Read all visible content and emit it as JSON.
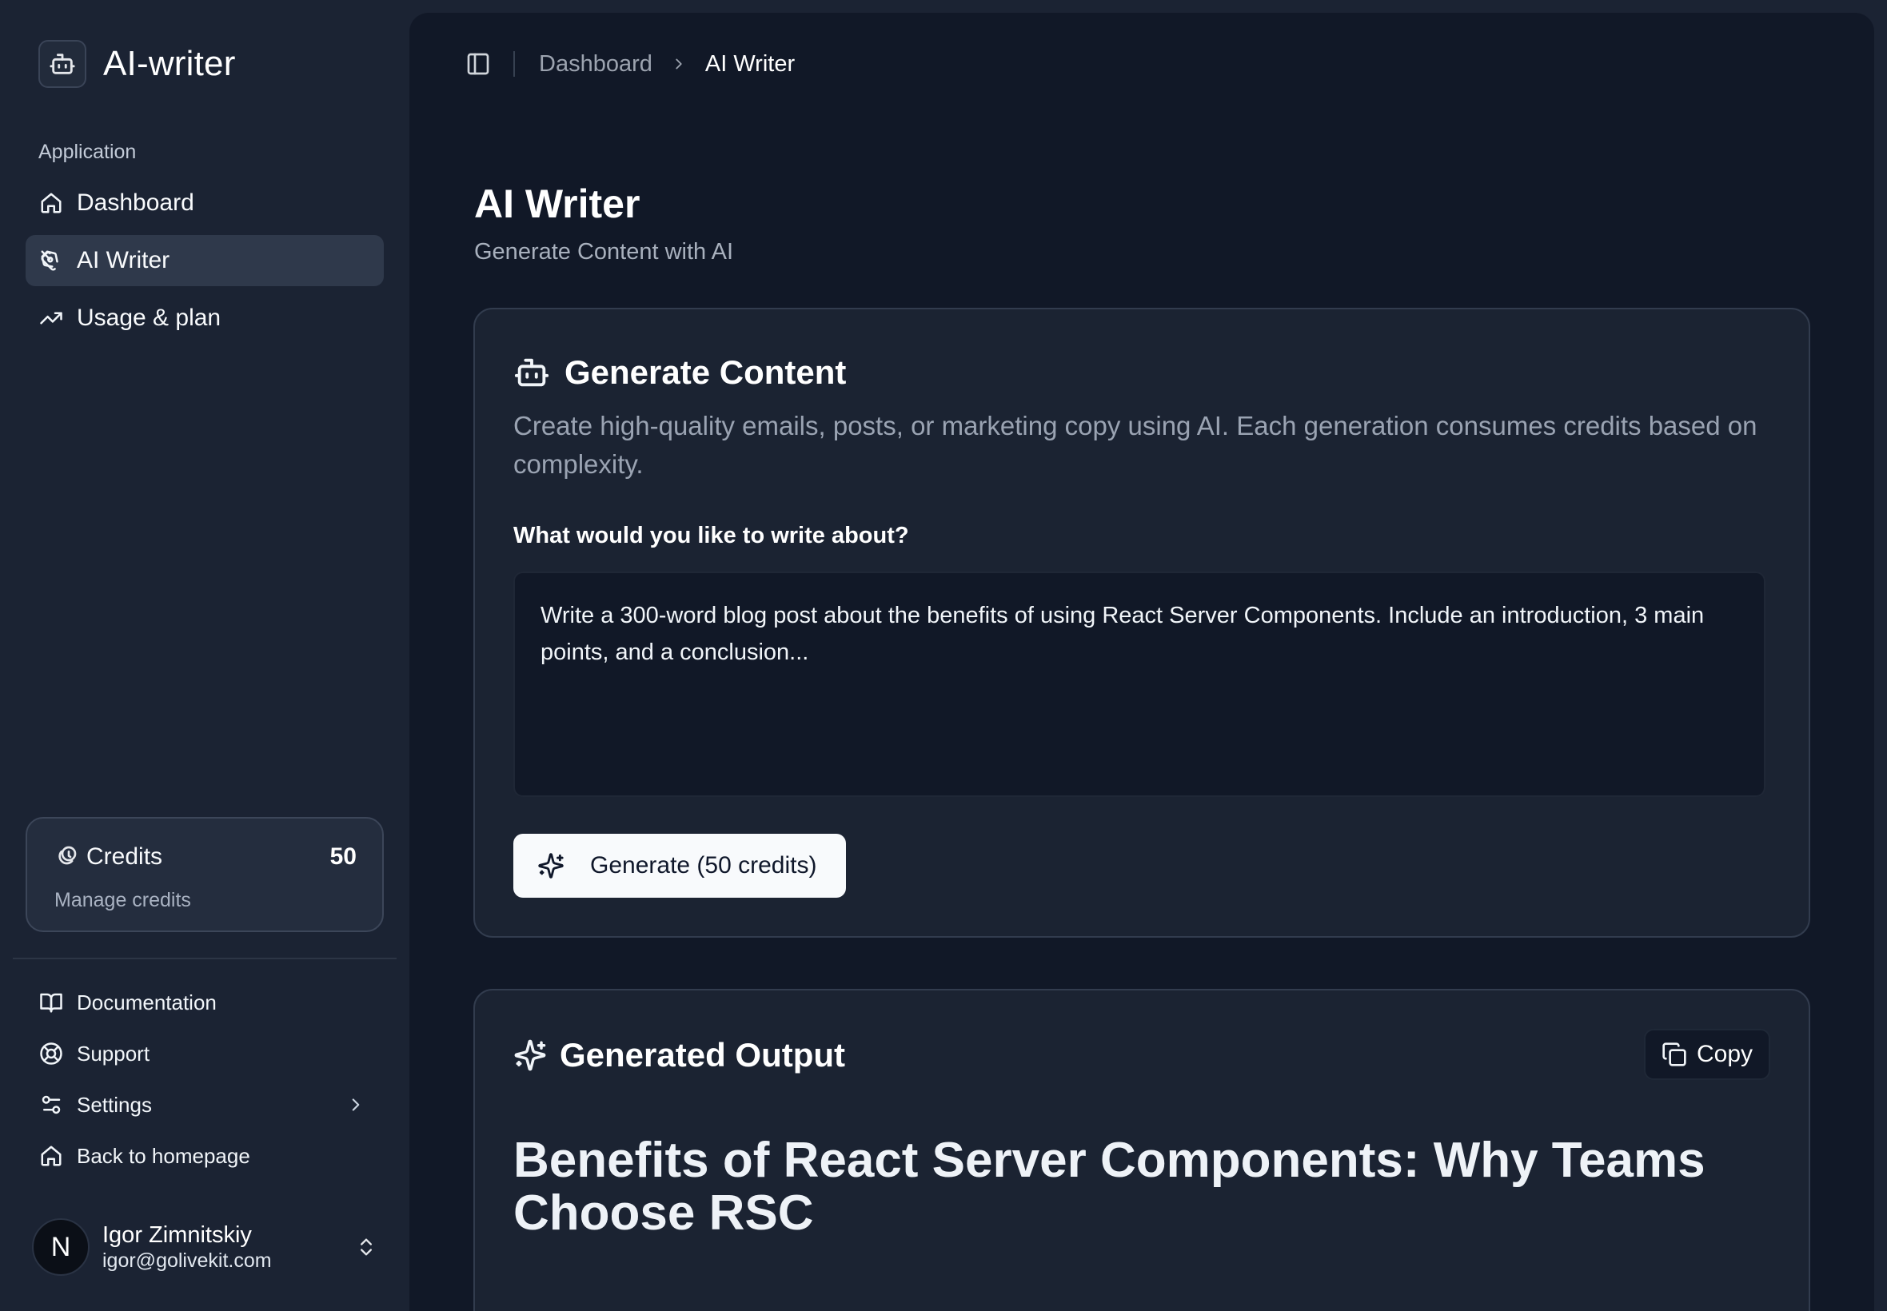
{
  "sidebar": {
    "brand": "AI-writer",
    "group_label": "Application",
    "nav": [
      {
        "label": "Dashboard",
        "icon": "home-icon"
      },
      {
        "label": "AI Writer",
        "icon": "pen-tool-icon",
        "active": true
      },
      {
        "label": "Usage & plan",
        "icon": "trending-up-icon"
      }
    ],
    "credits": {
      "label": "Credits",
      "value": "50",
      "sub": "Manage credits"
    },
    "footer": [
      {
        "label": "Documentation",
        "icon": "book-open-icon"
      },
      {
        "label": "Support",
        "icon": "life-buoy-icon"
      },
      {
        "label": "Settings",
        "icon": "sliders-icon"
      },
      {
        "label": "Back to homepage",
        "icon": "home-icon"
      }
    ],
    "user": {
      "avatar": "N",
      "name": "Igor Zimnitskiy",
      "email": "igor@golivekit.com"
    }
  },
  "breadcrumb": {
    "parent": "Dashboard",
    "current": "AI Writer"
  },
  "page": {
    "title": "AI Writer",
    "subtitle": "Generate Content with AI"
  },
  "generate_card": {
    "title": "Generate Content",
    "description": "Create high-quality emails, posts, or marketing copy using AI. Each generation consumes credits based on complexity.",
    "field_label": "What would you like to write about?",
    "prompt_value": "Write a 300-word blog post about the benefits of using React Server Components. Include an introduction, 3 main points, and a conclusion...",
    "button_label": "Generate (50 credits)"
  },
  "output_card": {
    "title": "Generated Output",
    "copy_label": "Copy",
    "heading": "Benefits of React Server Components: Why Teams Choose RSC"
  }
}
